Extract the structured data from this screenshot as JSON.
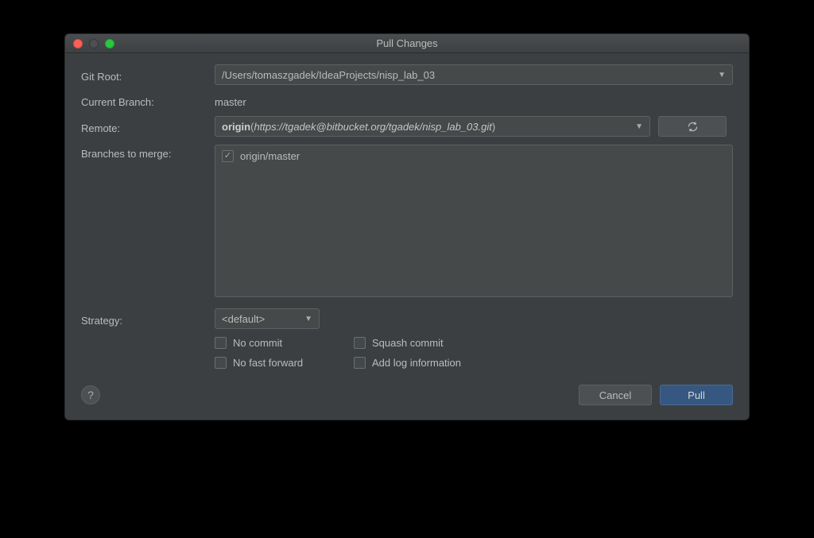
{
  "window": {
    "title": "Pull Changes"
  },
  "labels": {
    "gitRoot": "Git Root:",
    "currentBranch": "Current Branch:",
    "remote": "Remote:",
    "branchesToMerge": "Branches to merge:",
    "strategy": "Strategy:"
  },
  "values": {
    "gitRoot": "/Users/tomaszgadek/IdeaProjects/nisp_lab_03",
    "currentBranch": "master",
    "remoteName": "origin",
    "remoteUrl": "https://tgadek@bitbucket.org/tgadek/nisp_lab_03.git",
    "strategy": "<default>"
  },
  "branches": [
    {
      "label": "origin/master",
      "checked": true
    }
  ],
  "options": {
    "noCommit": "No commit",
    "squashCommit": "Squash commit",
    "noFastForward": "No fast forward",
    "addLogInfo": "Add log information"
  },
  "buttons": {
    "cancel": "Cancel",
    "pull": "Pull",
    "help": "?"
  }
}
